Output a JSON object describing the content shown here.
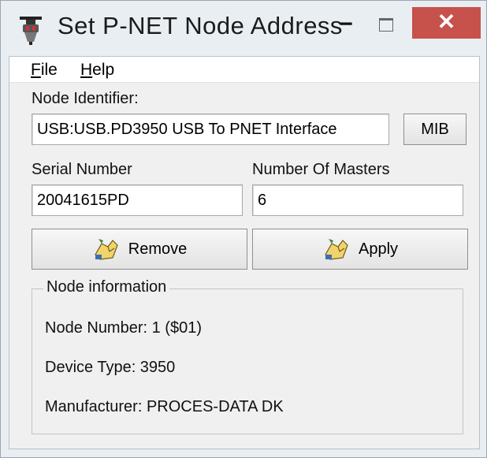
{
  "window": {
    "title": "Set P-NET Node Address",
    "minimize_glyph": "−",
    "close_glyph": "✕"
  },
  "menu": {
    "file": {
      "mnemonic": "F",
      "rest": "ile"
    },
    "help": {
      "mnemonic": "H",
      "rest": "elp"
    }
  },
  "node_identifier": {
    "label": "Node Identifier:",
    "value": "USB:USB.PD3950 USB To PNET Interface",
    "mib_button": "MIB"
  },
  "serial_number": {
    "label": "Serial Number",
    "value": "20041615PD"
  },
  "masters": {
    "label": "Number Of Masters",
    "value": "6"
  },
  "buttons": {
    "remove": "Remove",
    "apply": "Apply"
  },
  "node_information": {
    "title": "Node information",
    "node_number": "Node Number: 1 ($01)",
    "device_type": "Device Type: 3950",
    "manufacturer": "Manufacturer: PROCES-DATA DK"
  },
  "icons": {
    "app": "plug-icon",
    "remove": "hand-icon",
    "apply": "hand-icon",
    "close_color": "#c7514b"
  }
}
